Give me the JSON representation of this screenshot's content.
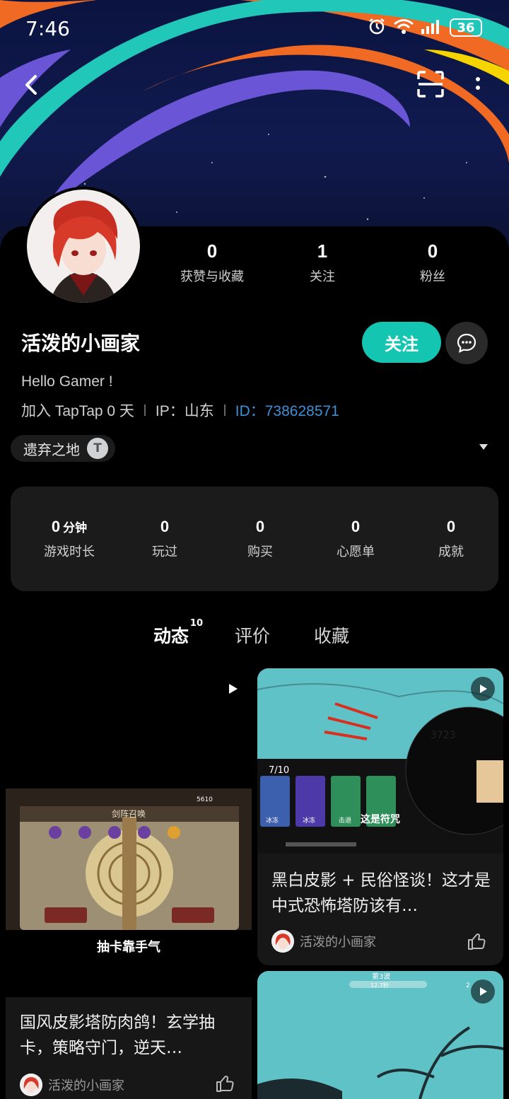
{
  "status_bar": {
    "time": "7:46",
    "battery": "36"
  },
  "profile": {
    "stats": [
      {
        "value": "0",
        "label": "获赞与收藏"
      },
      {
        "value": "1",
        "label": "关注"
      },
      {
        "value": "0",
        "label": "粉丝"
      }
    ],
    "username": "活泼的小画家",
    "follow_label": "关注",
    "bio": "Hello Gamer !",
    "joined": "加入 TapTap 0 天",
    "ip": "IP：山东",
    "user_id": "ID：738628571",
    "tag": "遗弃之地",
    "tag_badge": "T"
  },
  "game_stats": [
    {
      "value": "0",
      "unit": "分钟",
      "label": "游戏时长"
    },
    {
      "value": "0",
      "unit": "",
      "label": "玩过"
    },
    {
      "value": "0",
      "unit": "",
      "label": "购买"
    },
    {
      "value": "0",
      "unit": "",
      "label": "心愿单"
    },
    {
      "value": "0",
      "unit": "",
      "label": "成就"
    }
  ],
  "tabs": [
    {
      "label": "动态",
      "count": "10"
    },
    {
      "label": "评价"
    },
    {
      "label": "收藏"
    }
  ],
  "posts": [
    {
      "caption": "抽卡靠手气",
      "title": "国风皮影塔防肉鸽！玄学抽卡，策略守门，逆天…",
      "author": "活泼的小画家",
      "thumb_text": {
        "counter": "5610",
        "heading": "剑阵召唤"
      }
    },
    {
      "title": "黑白皮影 + 民俗怪谈！这才是中式恐怖塔防该有…",
      "author": "活泼的小画家",
      "thumb_text": {
        "score": "3723",
        "wave": "7/10",
        "spell": "这是符咒",
        "card1": "冰冻",
        "card2": "冰冻",
        "card3": "击退"
      }
    },
    {
      "thumb_text": {
        "wave": "第3波",
        "timer": "12.7秒",
        "count": "2"
      }
    }
  ],
  "colors": {
    "accent": "#14c5b1",
    "id_blue": "#3f8fd6",
    "card_bg": "#1b1b1b"
  }
}
